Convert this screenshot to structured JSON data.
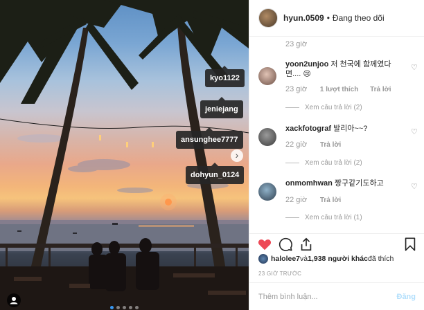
{
  "photo": {
    "tags": [
      "kyo1122",
      "jeniejang",
      "ansunghee7777",
      "dohyun_0124"
    ],
    "carousel": {
      "count": 5,
      "active": 0
    }
  },
  "header": {
    "username": "hyun.0509",
    "separator": "•",
    "follow_label": "Đang theo dõi"
  },
  "comments": {
    "top_time": "23 giờ",
    "items": [
      {
        "user": "yoon2unjoo",
        "text": " 저 천국에 함께였다면.... 😢",
        "time": "23 giờ",
        "likes": "1 lượt thích",
        "reply": "Trả lời",
        "view_replies": "Xem câu trả lời (2)"
      },
      {
        "user": "xackfotograf",
        "text": " 발리아~~?",
        "time": "22 giờ",
        "reply": "Trả lời",
        "view_replies": "Xem câu trả lời (2)"
      },
      {
        "user": "onmomhwan",
        "text": " 짱구같기도하고",
        "time": "22 giờ",
        "reply": "Trả lời",
        "view_replies": "Xem câu trả lời (1)"
      }
    ]
  },
  "likes": {
    "user": "halolee7",
    "mid": " và ",
    "count": "1,938 người khác",
    "suffix": " đã thích"
  },
  "timestamp": "23 GIỜ TRƯỚC",
  "add_comment": {
    "placeholder": "Thêm bình luận...",
    "post_label": "Đăng"
  },
  "colors": {
    "like_red": "#ed4956",
    "link_blue": "#3897f0",
    "post_disabled": "#b2dffc"
  }
}
